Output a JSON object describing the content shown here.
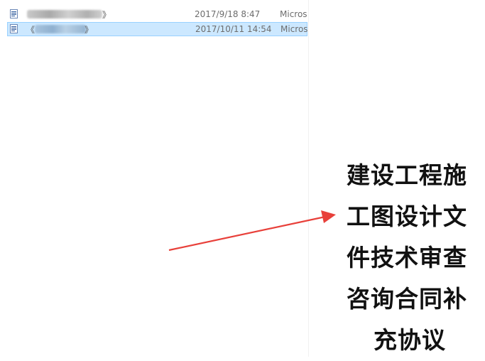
{
  "files": [
    {
      "name_prefix": "",
      "name_suffix": "》",
      "date": "2017/9/18 8:47",
      "type": "Micros",
      "selected": false,
      "icon": "word-document-icon"
    },
    {
      "name_prefix": "《",
      "name_suffix": "》",
      "date": "2017/10/11 14:54",
      "type": "Micros",
      "selected": true,
      "icon": "word-document-icon"
    }
  ],
  "annotation": {
    "arrow_color": "#e8403a",
    "title_lines": [
      "建设工程施",
      "工图设计文",
      "件技术审查",
      "咨询合同补",
      "充协议"
    ]
  },
  "colors": {
    "selection_bg": "#cce8ff",
    "selection_border": "#99d1ff",
    "text_muted": "#6d6d6d"
  }
}
